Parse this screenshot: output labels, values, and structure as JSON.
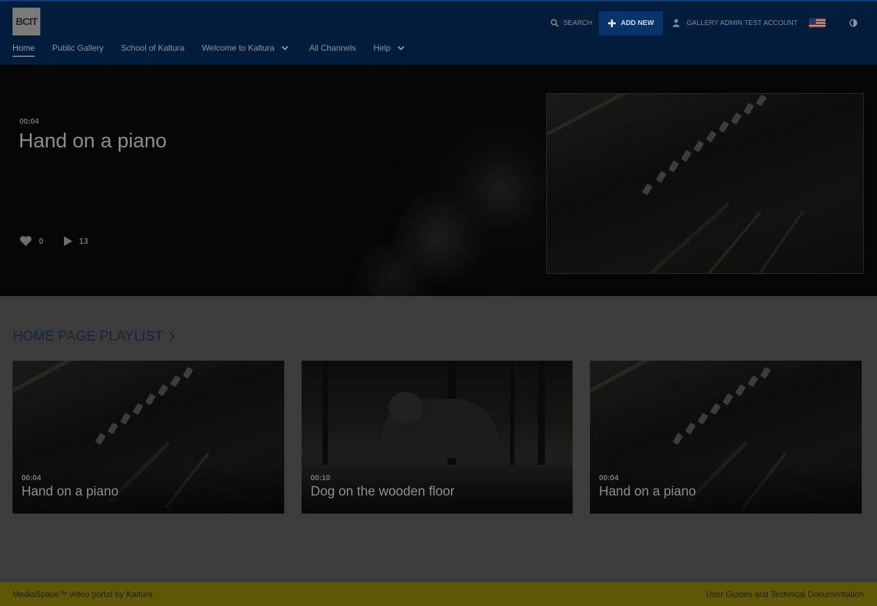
{
  "header": {
    "logo_text": "BCIT",
    "search_label": "SEARCH",
    "add_new_label": "ADD NEW",
    "account_label": "GALLERY ADMIN TEST ACCOUNT",
    "nav": [
      {
        "label": "Home",
        "active": true
      },
      {
        "label": "Public Gallery"
      },
      {
        "label": "School of Kaltura"
      },
      {
        "label": "Welcome to Kaltura",
        "dropdown": true
      },
      {
        "label": "All Channels"
      },
      {
        "label": "Help",
        "dropdown": true
      }
    ]
  },
  "hero": {
    "duration": "00:04",
    "title": "Hand on a piano",
    "likes": "0",
    "plays": "13"
  },
  "playlist": {
    "title": "HOME PAGE PLAYLIST",
    "items": [
      {
        "duration": "00:04",
        "title": "Hand on a piano",
        "thumb": "piano"
      },
      {
        "duration": "00:10",
        "title": "Dog on the wooden floor",
        "thumb": "dog"
      },
      {
        "duration": "00:04",
        "title": "Hand on a piano",
        "thumb": "piano"
      }
    ]
  },
  "footer": {
    "left": "MediaSpace™ video portal by Kaltura",
    "right": "User Guides and Technical Documentation"
  },
  "colors": {
    "header_bg": "#021d3c",
    "add_button_bg": "#05336a",
    "footer_bg": "#5f5606",
    "overlay_dim": "#3c3c3c"
  }
}
